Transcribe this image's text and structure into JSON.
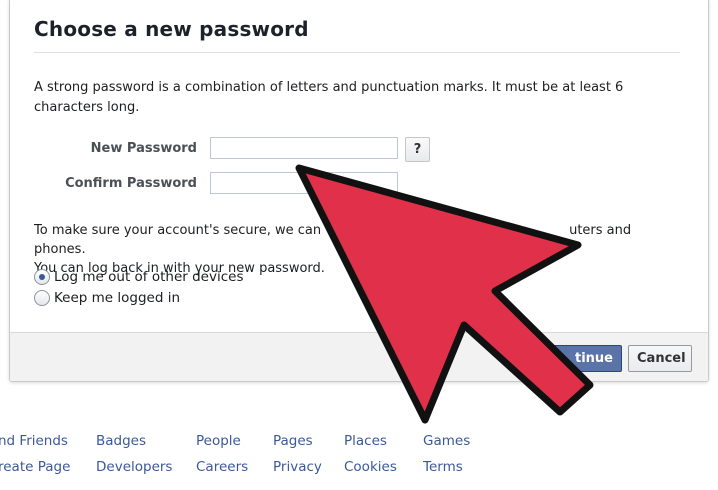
{
  "dialog": {
    "title": "Choose a new password",
    "info": "A strong password is a combination of letters and punctuation marks. It must be at least 6 characters long.",
    "new_password_label": "New Password",
    "new_password_value": "",
    "confirm_password_label": "Confirm Password",
    "confirm_password_value": "",
    "help_label": "?",
    "secure_line1": "To make sure your account's secure, we can",
    "secure_line1_end": "uters and phones.",
    "secure_line2": "You can log back in with your new password.",
    "radio_options": [
      {
        "label": "Log me out of other devices",
        "checked": true
      },
      {
        "label": "Keep me logged in",
        "checked": false
      }
    ],
    "continue_label": "tinue",
    "cancel_label": "Cancel"
  },
  "footer_links": {
    "row1": [
      "nd Friends",
      "Badges",
      "People",
      "Pages",
      "Places",
      "Games"
    ],
    "row2": [
      "reate Page",
      "Developers",
      "Careers",
      "Privacy",
      "Cookies",
      "Terms"
    ]
  },
  "colors": {
    "brand_blue": "#3b5998",
    "arrow_red": "#e0304a",
    "arrow_outline": "#111111"
  },
  "icons": {
    "overlay": "big-red-pointer-arrow-icon"
  }
}
